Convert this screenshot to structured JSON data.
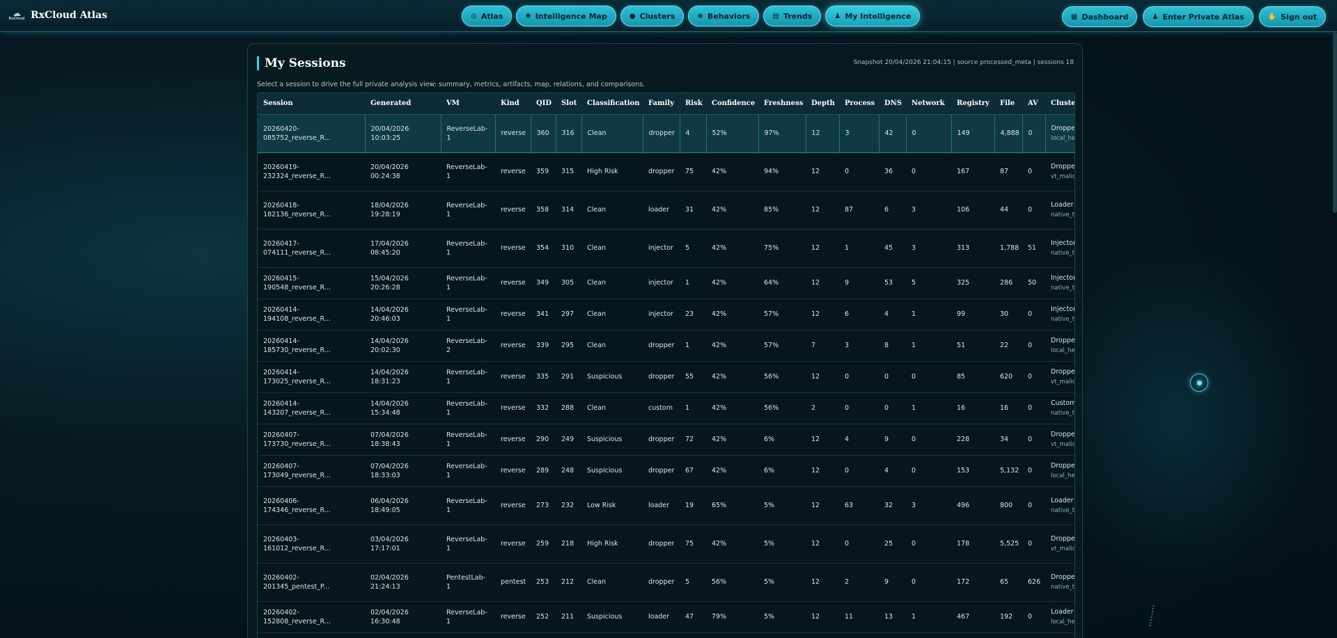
{
  "brand": {
    "name": "RxCloud Atlas",
    "logo_text": "RxCloud"
  },
  "nav": {
    "center": [
      {
        "label": "Atlas",
        "icon": "globe-icon",
        "glyph": "◎"
      },
      {
        "label": "Intelligence Map",
        "icon": "spider-icon",
        "glyph": "✺"
      },
      {
        "label": "Clusters",
        "icon": "cluster-icon",
        "glyph": "●"
      },
      {
        "label": "Behaviors",
        "icon": "brain-icon",
        "glyph": "❀"
      },
      {
        "label": "Trends",
        "icon": "chart-icon",
        "glyph": "▤"
      },
      {
        "label": "My Intelligence",
        "icon": "user-icon",
        "glyph": "♟"
      }
    ],
    "right": [
      {
        "label": "Dashboard",
        "icon": "dashboard-icon",
        "glyph": "▦"
      },
      {
        "label": "Enter Private Atlas",
        "icon": "user-icon",
        "glyph": "♟"
      },
      {
        "label": "Sign out",
        "icon": "hand-icon",
        "glyph": "✋"
      }
    ],
    "active": "My Intelligence"
  },
  "panel": {
    "title": "My Sessions",
    "meta": "Snapshot 20/04/2026 21:04:15 | source processed_meta | sessions 18",
    "description": "Select a session to drive the full private analysis view: summary, metrics, artifacts, map, relations, and comparisons."
  },
  "table": {
    "columns": [
      "Session",
      "Generated",
      "VM",
      "Kind",
      "QID",
      "Slot",
      "Classification",
      "Family",
      "Risk",
      "Confidence",
      "Freshness",
      "Depth",
      "Process",
      "DNS",
      "Network",
      "Registry",
      "File",
      "AV",
      "Cluster"
    ],
    "rows": [
      {
        "session": "20260420-085752_reverse_R...",
        "generated": "20/04/2026 10:03:25",
        "vm": "ReverseLab-1",
        "kind": "reverse",
        "qid": "360",
        "slot": "316",
        "classification": "Clean",
        "family": "dropper",
        "risk": "4",
        "confidence": "52%",
        "freshness": "97%",
        "depth": "12",
        "process": "3",
        "dns": "42",
        "network": "0",
        "registry": "149",
        "file": "4,888",
        "av": "0",
        "cluster": "Dropper P",
        "cluster_sub": "local_heuri",
        "selected": true
      },
      {
        "session": "20260419-232324_reverse_R...",
        "generated": "20/04/2026 00:24:38",
        "vm": "ReverseLab-1",
        "kind": "reverse",
        "qid": "359",
        "slot": "315",
        "classification": "High Risk",
        "family": "dropper",
        "risk": "75",
        "confidence": "42%",
        "freshness": "94%",
        "depth": "12",
        "process": "0",
        "dns": "36",
        "network": "0",
        "registry": "167",
        "file": "87",
        "av": "0",
        "cluster": "Dropper P",
        "cluster_sub": "vt_malicio"
      },
      {
        "session": "20260418-182136_reverse_R...",
        "generated": "18/04/2026 19:28:19",
        "vm": "ReverseLab-1",
        "kind": "reverse",
        "qid": "358",
        "slot": "314",
        "classification": "Clean",
        "family": "loader",
        "risk": "31",
        "confidence": "42%",
        "freshness": "85%",
        "depth": "12",
        "process": "87",
        "dns": "6",
        "network": "3",
        "registry": "106",
        "file": "44",
        "av": "0",
        "cluster": "Loader P",
        "cluster_sub": "native_tele"
      },
      {
        "session": "20260417-074111_reverse_R...",
        "generated": "17/04/2026 08:45:20",
        "vm": "ReverseLab-1",
        "kind": "reverse",
        "qid": "354",
        "slot": "310",
        "classification": "Clean",
        "family": "injector",
        "risk": "5",
        "confidence": "42%",
        "freshness": "75%",
        "depth": "12",
        "process": "1",
        "dns": "45",
        "network": "3",
        "registry": "313",
        "file": "1,788",
        "av": "51",
        "cluster": "Injector P",
        "cluster_sub": "native_tele"
      },
      {
        "session": "20260415-190548_reverse_R...",
        "generated": "15/04/2026 20:26:28",
        "vm": "ReverseLab-1",
        "kind": "reverse",
        "qid": "349",
        "slot": "305",
        "classification": "Clean",
        "family": "injector",
        "risk": "1",
        "confidence": "42%",
        "freshness": "64%",
        "depth": "12",
        "process": "9",
        "dns": "53",
        "network": "5",
        "registry": "325",
        "file": "286",
        "av": "50",
        "cluster": "Injector P",
        "cluster_sub": "native_tele"
      },
      {
        "session": "20260414-194108_reverse_R...",
        "generated": "14/04/2026 20:46:03",
        "vm": "ReverseLab-1",
        "kind": "reverse",
        "qid": "341",
        "slot": "297",
        "classification": "Clean",
        "family": "injector",
        "risk": "23",
        "confidence": "42%",
        "freshness": "57%",
        "depth": "12",
        "process": "6",
        "dns": "4",
        "network": "1",
        "registry": "99",
        "file": "30",
        "av": "0",
        "cluster": "Injector P",
        "cluster_sub": "native_tele"
      },
      {
        "session": "20260414-185730_reverse_R...",
        "generated": "14/04/2026 20:02:30",
        "vm": "ReverseLab-2",
        "kind": "reverse",
        "qid": "339",
        "slot": "295",
        "classification": "Clean",
        "family": "dropper",
        "risk": "1",
        "confidence": "42%",
        "freshness": "57%",
        "depth": "7",
        "process": "3",
        "dns": "8",
        "network": "1",
        "registry": "51",
        "file": "22",
        "av": "0",
        "cluster": "Dropper P",
        "cluster_sub": "local_heuri"
      },
      {
        "session": "20260414-173025_reverse_R...",
        "generated": "14/04/2026 18:31:23",
        "vm": "ReverseLab-1",
        "kind": "reverse",
        "qid": "335",
        "slot": "291",
        "classification": "Suspicious",
        "family": "dropper",
        "risk": "55",
        "confidence": "42%",
        "freshness": "56%",
        "depth": "12",
        "process": "0",
        "dns": "0",
        "network": "0",
        "registry": "85",
        "file": "620",
        "av": "0",
        "cluster": "Dropper P",
        "cluster_sub": "vt_malicio"
      },
      {
        "session": "20260414-143207_reverse_R...",
        "generated": "14/04/2026 15:34:48",
        "vm": "ReverseLab-1",
        "kind": "reverse",
        "qid": "332",
        "slot": "288",
        "classification": "Clean",
        "family": "custom",
        "risk": "1",
        "confidence": "42%",
        "freshness": "56%",
        "depth": "2",
        "process": "0",
        "dns": "0",
        "network": "1",
        "registry": "16",
        "file": "16",
        "av": "0",
        "cluster": "Custom P",
        "cluster_sub": "native_tele"
      },
      {
        "session": "20260407-173730_reverse_R...",
        "generated": "07/04/2026 18:38:43",
        "vm": "ReverseLab-1",
        "kind": "reverse",
        "qid": "290",
        "slot": "249",
        "classification": "Suspicious",
        "family": "dropper",
        "risk": "72",
        "confidence": "42%",
        "freshness": "6%",
        "depth": "12",
        "process": "4",
        "dns": "9",
        "network": "0",
        "registry": "228",
        "file": "34",
        "av": "0",
        "cluster": "Dropper P",
        "cluster_sub": "vt_malicio"
      },
      {
        "session": "20260407-173049_reverse_R...",
        "generated": "07/04/2026 18:33:03",
        "vm": "ReverseLab-1",
        "kind": "reverse",
        "qid": "289",
        "slot": "248",
        "classification": "Suspicious",
        "family": "dropper",
        "risk": "67",
        "confidence": "42%",
        "freshness": "6%",
        "depth": "12",
        "process": "0",
        "dns": "4",
        "network": "0",
        "registry": "153",
        "file": "5,132",
        "av": "0",
        "cluster": "Dropper P",
        "cluster_sub": "local_heuri"
      },
      {
        "session": "20260406-174346_reverse_R...",
        "generated": "06/04/2026 18:49:05",
        "vm": "ReverseLab-1",
        "kind": "reverse",
        "qid": "273",
        "slot": "232",
        "classification": "Low Risk",
        "family": "loader",
        "risk": "19",
        "confidence": "65%",
        "freshness": "5%",
        "depth": "12",
        "process": "63",
        "dns": "32",
        "network": "3",
        "registry": "496",
        "file": "800",
        "av": "0",
        "cluster": "Loader P",
        "cluster_sub": "native_tele"
      },
      {
        "session": "20260403-161012_reverse_R...",
        "generated": "03/04/2026 17:17:01",
        "vm": "ReverseLab-1",
        "kind": "reverse",
        "qid": "259",
        "slot": "218",
        "classification": "High Risk",
        "family": "dropper",
        "risk": "75",
        "confidence": "42%",
        "freshness": "5%",
        "depth": "12",
        "process": "0",
        "dns": "25",
        "network": "0",
        "registry": "178",
        "file": "5,525",
        "av": "0",
        "cluster": "Dropper P",
        "cluster_sub": "vt_malicio"
      },
      {
        "session": "20260402-201345_pentest_P...",
        "generated": "02/04/2026 21:24:13",
        "vm": "PentestLab-1",
        "kind": "pentest",
        "qid": "253",
        "slot": "212",
        "classification": "Clean",
        "family": "dropper",
        "risk": "5",
        "confidence": "56%",
        "freshness": "5%",
        "depth": "12",
        "process": "2",
        "dns": "9",
        "network": "0",
        "registry": "172",
        "file": "65",
        "av": "626",
        "cluster": "Dropper P",
        "cluster_sub": "native_tele"
      },
      {
        "session": "20260402-152808_reverse_R...",
        "generated": "02/04/2026 16:30:48",
        "vm": "ReverseLab-1",
        "kind": "reverse",
        "qid": "252",
        "slot": "211",
        "classification": "Suspicious",
        "family": "loader",
        "risk": "47",
        "confidence": "79%",
        "freshness": "5%",
        "depth": "12",
        "process": "11",
        "dns": "13",
        "network": "1",
        "registry": "467",
        "file": "192",
        "av": "0",
        "cluster": "Loader P",
        "cluster_sub": "local_heuri"
      },
      {
        "session": "",
        "generated": "",
        "vm": "",
        "kind": "",
        "qid": "",
        "slot": "",
        "classification": "",
        "family": "",
        "risk": "",
        "confidence": "",
        "freshness": "",
        "depth": "",
        "process": "",
        "dns": "",
        "network": "",
        "registry": "",
        "file": "",
        "av": "",
        "cluster": "",
        "cluster_sub": ""
      }
    ]
  }
}
